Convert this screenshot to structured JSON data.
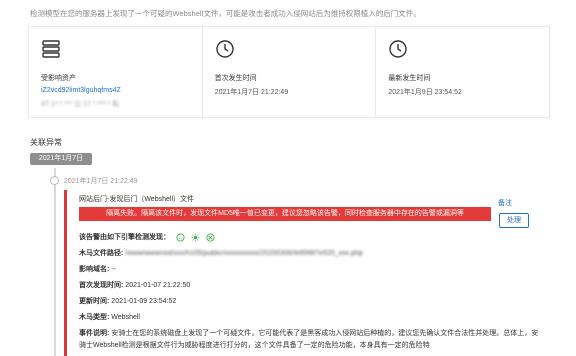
{
  "header_note": "检测模型在您的服务器上发现了一个可疑的Webshell文件，可能是攻击者成功入侵网站后为维持权限植入的后门文件。",
  "cards": {
    "asset": {
      "label": "受影响资产",
      "id": "iZ2vcd92limt3lguhqfms4Z",
      "sub": "47.1*.*.*** 公 17.*.***.* 私"
    },
    "first": {
      "label": "首次发生时间",
      "value": "2021年1月7日 21:22:49"
    },
    "last": {
      "label": "最新发生时间",
      "value": "2021年1月9日 23:54:52"
    }
  },
  "section_title": "关联异常",
  "date_pill": "2021年1月7日",
  "event": {
    "time": "2021年1月7日 21:22:49",
    "title": "网站后门-发现后门（Webshell）文件",
    "remark": "备注",
    "alert": "隔离失败。隔离该文件时，发现文件MD5唯一值已变更，建议您忽略该告警，同时检查服务器中存在的告警或漏洞等",
    "button": "处理",
    "engines_label": "该告警由如下引擎检测发现：",
    "path_label": "木马文件路径:",
    "path_value": "/www/wwwroot/xxx/h105/public/xxxxxxxxxx/20200306/fe85f6f7e520_xxx.php",
    "domain_label": "影响域名:",
    "domain_value": "--",
    "first_label": "首次发现时间:",
    "first_value": "2021-01-07 21:22:50",
    "update_label": "更新时间:",
    "update_value": "2021-01-09 23:54:52",
    "type_label": "木马类型:",
    "type_value": "Webshell",
    "desc_label": "事件说明:",
    "desc_value": "安骑士在您的系统磁盘上发现了一个可疑文件，它可能代表了是黑客成功入侵网站后种植的，建议您先确认文件合法性并处理。总体上，安骑士Webshell检测是根据文件行为威胁程度进行打分的，这个文件具备了一定的危险功能，本身具有一定的危险特"
  },
  "colors": {
    "accent": "#1f6fd1",
    "alert": "#e33a3a",
    "engine": "#3fae49"
  }
}
